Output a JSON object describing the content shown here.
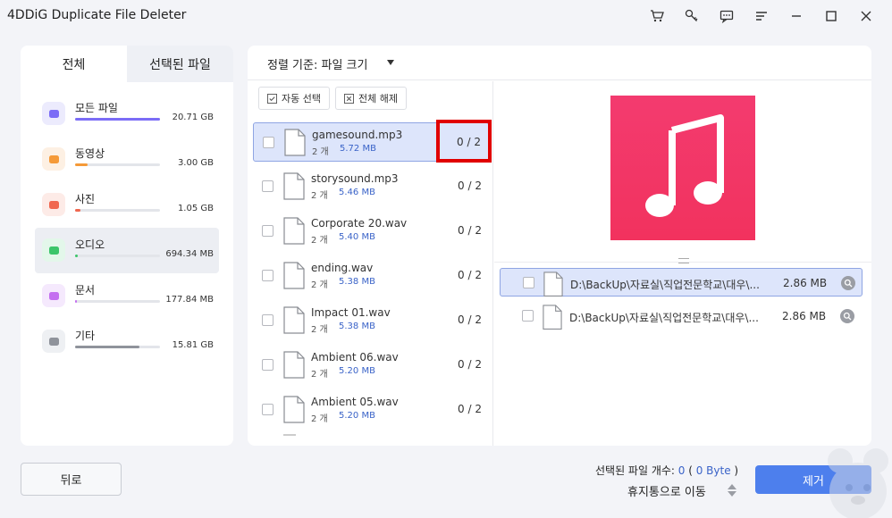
{
  "window": {
    "title": "4DDiG Duplicate File Deleter",
    "controls": [
      "cart-icon",
      "key-icon",
      "feedback-icon",
      "menu-icon",
      "minimize-icon",
      "maximize-icon",
      "close-icon"
    ]
  },
  "sidebar": {
    "tabs": [
      {
        "label": "전체",
        "active": true
      },
      {
        "label": "선택된 파일",
        "active": false
      }
    ],
    "categories": [
      {
        "label": "모든 파일",
        "size": "20.71 GB",
        "icon": "folder-icon",
        "color": "#7b6cf6",
        "bg": "#ecebfd",
        "fill": 1.0,
        "active": false
      },
      {
        "label": "동영상",
        "size": "3.00 GB",
        "icon": "video-icon",
        "color": "#f59a38",
        "bg": "#fdf0e3",
        "fill": 0.15,
        "active": false
      },
      {
        "label": "사진",
        "size": "1.05 GB",
        "icon": "photo-icon",
        "color": "#f0674f",
        "bg": "#fdebe7",
        "fill": 0.06,
        "active": false
      },
      {
        "label": "오디오",
        "size": "694.34 MB",
        "icon": "audio-icon",
        "color": "#3cc56a",
        "bg": "#e3f7ea",
        "fill": 0.03,
        "active": true
      },
      {
        "label": "문서",
        "size": "177.84 MB",
        "icon": "document-icon",
        "color": "#c46ff0",
        "bg": "#f5e9fd",
        "fill": 0.02,
        "active": false
      },
      {
        "label": "기타",
        "size": "15.81 GB",
        "icon": "other-icon",
        "color": "#8f939b",
        "bg": "#eef0f3",
        "fill": 0.76,
        "active": false
      }
    ]
  },
  "main": {
    "sort_label": "정렬 기준: 파일 크기",
    "auto_select_label": "자동 선택",
    "deselect_all_label": "전체 해제",
    "files": [
      {
        "name": "gamesound.mp3",
        "count": "2 개",
        "size": "5.72 MB",
        "ratio": "0 / 2",
        "selected": true
      },
      {
        "name": "storysound.mp3",
        "count": "2 개",
        "size": "5.46 MB",
        "ratio": "0 / 2",
        "selected": false
      },
      {
        "name": "Corporate 20.wav",
        "count": "2 개",
        "size": "5.40 MB",
        "ratio": "0 / 2",
        "selected": false
      },
      {
        "name": "ending.wav",
        "count": "2 개",
        "size": "5.38 MB",
        "ratio": "0 / 2",
        "selected": false
      },
      {
        "name": "Impact 01.wav",
        "count": "2 개",
        "size": "5.38 MB",
        "ratio": "0 / 2",
        "selected": false
      },
      {
        "name": "Ambient 06.wav",
        "count": "2 개",
        "size": "5.20 MB",
        "ratio": "0 / 2",
        "selected": false
      },
      {
        "name": "Ambient 05.wav",
        "count": "2 개",
        "size": "5.20 MB",
        "ratio": "0 / 2",
        "selected": false
      }
    ],
    "preview_paths": [
      {
        "path": "D:\\BackUp\\자료실\\직업전문학교\\대우\\...",
        "size": "2.86 MB",
        "selected": true
      },
      {
        "path": "D:\\BackUp\\자료실\\직업전문학교\\대우\\...",
        "size": "2.86 MB",
        "selected": false
      }
    ]
  },
  "footer": {
    "back_label": "뒤로",
    "selected_prefix": "선택된 파일 개수: ",
    "selected_count": "0",
    "selected_open": " ( ",
    "selected_bytes": "0 Byte",
    "selected_close": " )",
    "trash_label": "휴지통으로 이동",
    "remove_label": "제거"
  },
  "colors": {
    "accent": "#4d7fed",
    "highlight": "#e10000",
    "music_tile": "#f2325e"
  }
}
